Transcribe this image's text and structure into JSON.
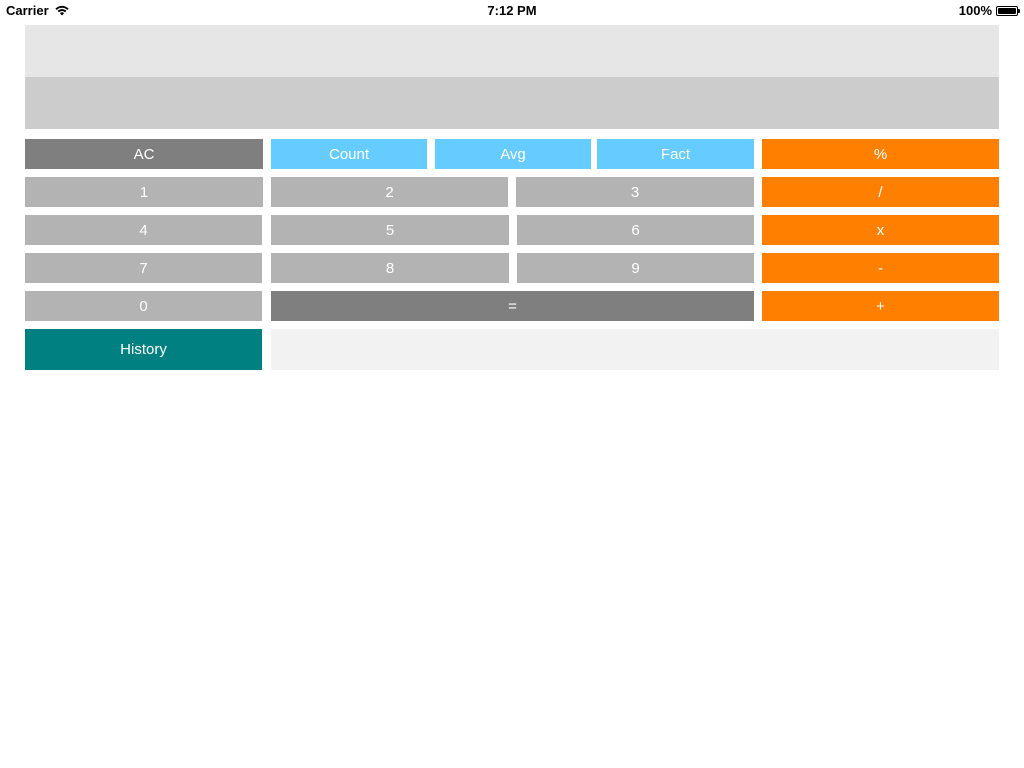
{
  "status_bar": {
    "carrier": "Carrier",
    "time": "7:12 PM",
    "battery": "100%"
  },
  "display": {
    "expression": "",
    "result": ""
  },
  "buttons": {
    "ac": "AC",
    "count": "Count",
    "avg": "Avg",
    "fact": "Fact",
    "percent": "%",
    "one": "1",
    "two": "2",
    "three": "3",
    "divide": "/",
    "four": "4",
    "five": "5",
    "six": "6",
    "multiply": "x",
    "seven": "7",
    "eight": "8",
    "nine": "9",
    "minus": "-",
    "zero": "0",
    "equals": "=",
    "plus": "+",
    "history": "History"
  },
  "colors": {
    "operator": "#ff8000",
    "function": "#66ccff",
    "digit": "#b3b3b3",
    "control": "#7f7f7f",
    "history": "#008080"
  }
}
